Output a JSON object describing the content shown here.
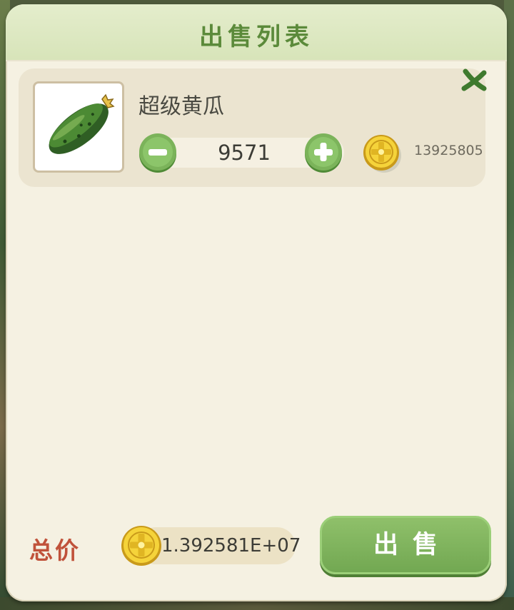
{
  "dialog": {
    "title": "出售列表",
    "close_icon": "close-x-icon"
  },
  "item": {
    "name": "超级黄瓜",
    "icon": "cucumber-icon",
    "quantity": "9571",
    "price": "13925805",
    "coin_icon": "gold-coin-icon"
  },
  "footer": {
    "total_label": "总价",
    "total_value": "1.392581E+07",
    "sell_label": "出售"
  },
  "colors": {
    "title": "#5b8a3a",
    "accent_green": "#7bb35a",
    "total_label": "#c0523a",
    "panel": "#f5f1e2"
  }
}
